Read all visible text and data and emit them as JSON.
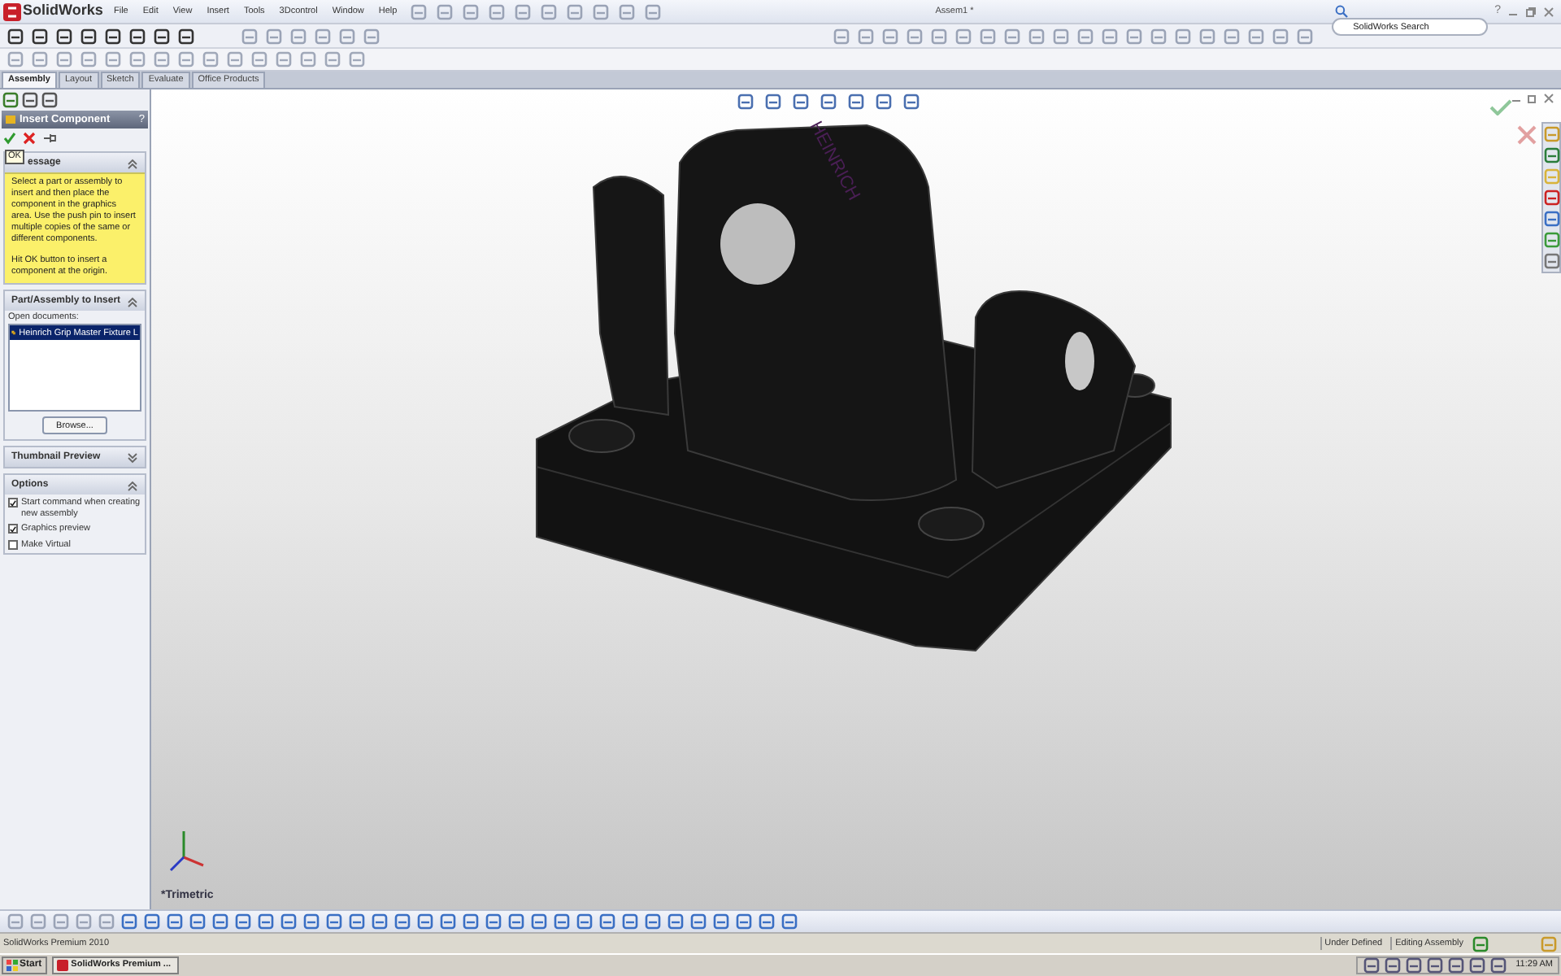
{
  "app": {
    "logo": "SolidWorks",
    "title": "Assem1 *",
    "search": {
      "placeholder": "SolidWorks Search"
    },
    "help": "?"
  },
  "menu": [
    "File",
    "Edit",
    "View",
    "Insert",
    "Tools",
    "3Dcontrol",
    "Window",
    "Help"
  ],
  "tabs": [
    {
      "label": "Assembly",
      "selected": true
    },
    {
      "label": "Layout",
      "selected": false
    },
    {
      "label": "Sketch",
      "selected": false
    },
    {
      "label": "Evaluate",
      "selected": false
    },
    {
      "label": "Office Products",
      "selected": false
    }
  ],
  "property_manager": {
    "title": "Insert Component",
    "help": "?",
    "tooltip": "OK",
    "sections": [
      {
        "kind": "message",
        "title": "essage",
        "expanded": true,
        "paragraphs": [
          "Select a part or assembly to insert and then place the component in the graphics area. Use the push pin to insert multiple copies of the same or different components.",
          "Hit OK button to insert a component at the origin."
        ]
      },
      {
        "kind": "documents",
        "title": "Part/Assembly to Insert",
        "expanded": true,
        "label": "Open documents:",
        "items": [
          {
            "label": "Heinrich Grip Master Fixture L",
            "selected": true
          }
        ],
        "button": "Browse..."
      },
      {
        "kind": "empty",
        "title": "Thumbnail Preview",
        "expanded": false
      },
      {
        "kind": "options",
        "title": "Options",
        "expanded": true,
        "options": [
          {
            "label": "Start command when creating new assembly",
            "checked": true
          },
          {
            "label": "Graphics preview",
            "checked": true
          },
          {
            "label": "Make Virtual",
            "checked": false
          }
        ]
      }
    ]
  },
  "viewport": {
    "view_name": "*Trimetric",
    "model_label": "HEINRICH"
  },
  "status_bar": {
    "product": "SolidWorks Premium 2010",
    "fields": [
      "Under Defined",
      "Editing Assembly"
    ]
  },
  "taskbar": {
    "start": "Start",
    "windows": [
      "SolidWorks Premium ..."
    ],
    "clock": "11:29 AM"
  }
}
